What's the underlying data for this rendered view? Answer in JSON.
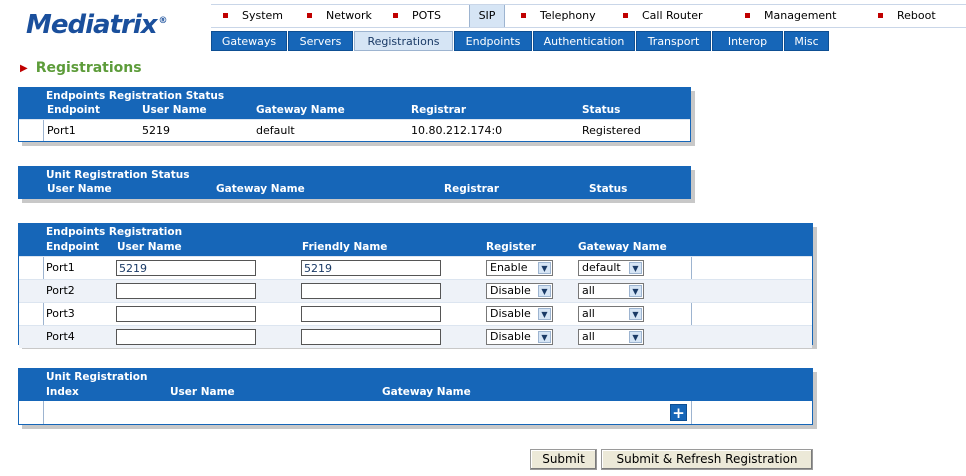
{
  "logo": "Mediatrix",
  "logo_mark": "®",
  "top_nav": [
    "System",
    "Network",
    "POTS",
    "SIP",
    "Telephony",
    "Call Router",
    "Management",
    "Reboot"
  ],
  "top_nav_active": "SIP",
  "sub_nav": [
    "Gateways",
    "Servers",
    "Registrations",
    "Endpoints",
    "Authentication",
    "Transport",
    "Interop",
    "Misc"
  ],
  "sub_nav_active": "Registrations",
  "page_title": "Registrations",
  "endpoints_status": {
    "title": "Endpoints Registration Status",
    "headers": [
      "Endpoint",
      "User Name",
      "Gateway Name",
      "Registrar",
      "Status"
    ],
    "rows": [
      {
        "endpoint": "Port1",
        "user": "5219",
        "gateway": "default",
        "registrar": "10.80.212.174:0",
        "status": "Registered"
      }
    ]
  },
  "unit_status": {
    "title": "Unit Registration Status",
    "headers": [
      "User Name",
      "Gateway Name",
      "Registrar",
      "Status"
    ]
  },
  "endpoints_registration": {
    "title": "Endpoints Registration",
    "headers": [
      "Endpoint",
      "User Name",
      "Friendly Name",
      "Register",
      "Gateway Name"
    ],
    "rows": [
      {
        "endpoint": "Port1",
        "user": "5219",
        "friendly": "5219",
        "register": "Enable",
        "gateway": "default"
      },
      {
        "endpoint": "Port2",
        "user": "",
        "friendly": "",
        "register": "Disable",
        "gateway": "all"
      },
      {
        "endpoint": "Port3",
        "user": "",
        "friendly": "",
        "register": "Disable",
        "gateway": "all"
      },
      {
        "endpoint": "Port4",
        "user": "",
        "friendly": "",
        "register": "Disable",
        "gateway": "all"
      }
    ]
  },
  "unit_registration": {
    "title": "Unit Registration",
    "headers": [
      "Index",
      "User Name",
      "Gateway Name"
    ],
    "add_label": "+"
  },
  "buttons": {
    "submit": "Submit",
    "submit_refresh": "Submit & Refresh Registration"
  },
  "colors": {
    "header_blue": "#1666b8",
    "title_green": "#5d9c3a",
    "bullet_red": "#c00000"
  }
}
